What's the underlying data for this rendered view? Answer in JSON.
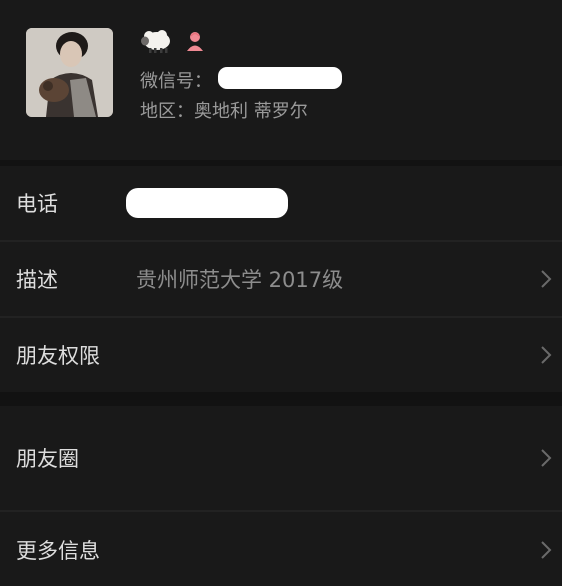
{
  "profile": {
    "wechat_id_label": "微信号：",
    "region_label": "地区：",
    "region_value": "奥地利 蒂罗尔",
    "nickname_emoji_icon": "sheep-icon",
    "gender_icon": "female-icon"
  },
  "rows": [
    {
      "label": "电话",
      "value": "",
      "redacted": true
    },
    {
      "label": "描述",
      "value": "贵州师范大学 2017级"
    },
    {
      "label": "朋友权限",
      "value": ""
    },
    {
      "label": "朋友圈",
      "value": ""
    },
    {
      "label": "更多信息",
      "value": ""
    }
  ],
  "colors": {
    "background": "#181818",
    "label": "#dddddd",
    "value": "#8d8d8d",
    "redaction": "#ffffff"
  }
}
